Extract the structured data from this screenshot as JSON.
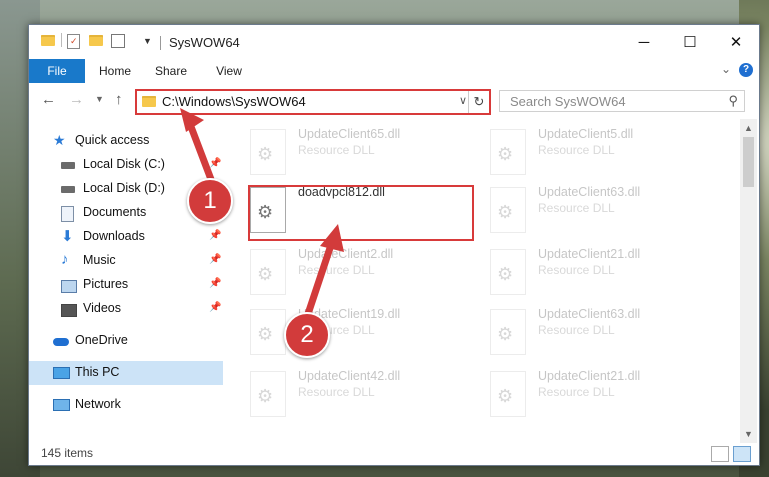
{
  "window": {
    "title": "SysWOW64",
    "controls": {
      "minimize": "─",
      "maximize": "☐",
      "close": "✕"
    }
  },
  "ribbon": {
    "tabs": [
      "File",
      "Home",
      "Share",
      "View"
    ],
    "help": "?"
  },
  "address": {
    "path": "C:\\Windows\\SysWOW64",
    "search_placeholder": "Search SysWOW64"
  },
  "sidebar": {
    "quick_access": "Quick access",
    "items": [
      {
        "label": "Local Disk (C:)",
        "pinned": true
      },
      {
        "label": "Local Disk (D:)",
        "pinned": false
      },
      {
        "label": "Documents",
        "pinned": true
      },
      {
        "label": "Downloads",
        "pinned": true
      },
      {
        "label": "Music",
        "pinned": true
      },
      {
        "label": "Pictures",
        "pinned": true
      },
      {
        "label": "Videos",
        "pinned": true
      }
    ],
    "onedrive": "OneDrive",
    "this_pc": "This PC",
    "network": "Network"
  },
  "files": {
    "left": [
      {
        "name": "UpdateClient65.dll",
        "type": "Resource DLL"
      },
      {
        "name": "doadvpcl812.dll",
        "type": ""
      },
      {
        "name": "UpdateClient2.dll",
        "type": "Resource DLL"
      },
      {
        "name": "UpdateClient19.dll",
        "type": "Resource DLL"
      },
      {
        "name": "UpdateClient42.dll",
        "type": "Resource DLL"
      }
    ],
    "right": [
      {
        "name": "UpdateClient5.dll",
        "type": "Resource DLL"
      },
      {
        "name": "UpdateClient63.dll",
        "type": "Resource DLL"
      },
      {
        "name": "UpdateClient21.dll",
        "type": "Resource DLL"
      },
      {
        "name": "UpdateClient63.dll",
        "type": "Resource DLL"
      },
      {
        "name": "UpdateClient21.dll",
        "type": "Resource DLL"
      }
    ]
  },
  "status": {
    "count": "145 items"
  },
  "callouts": {
    "one": "1",
    "two": "2"
  },
  "colors": {
    "accent": "#1979ca",
    "highlight": "#d83a3a",
    "selected": "#cce3f7"
  }
}
